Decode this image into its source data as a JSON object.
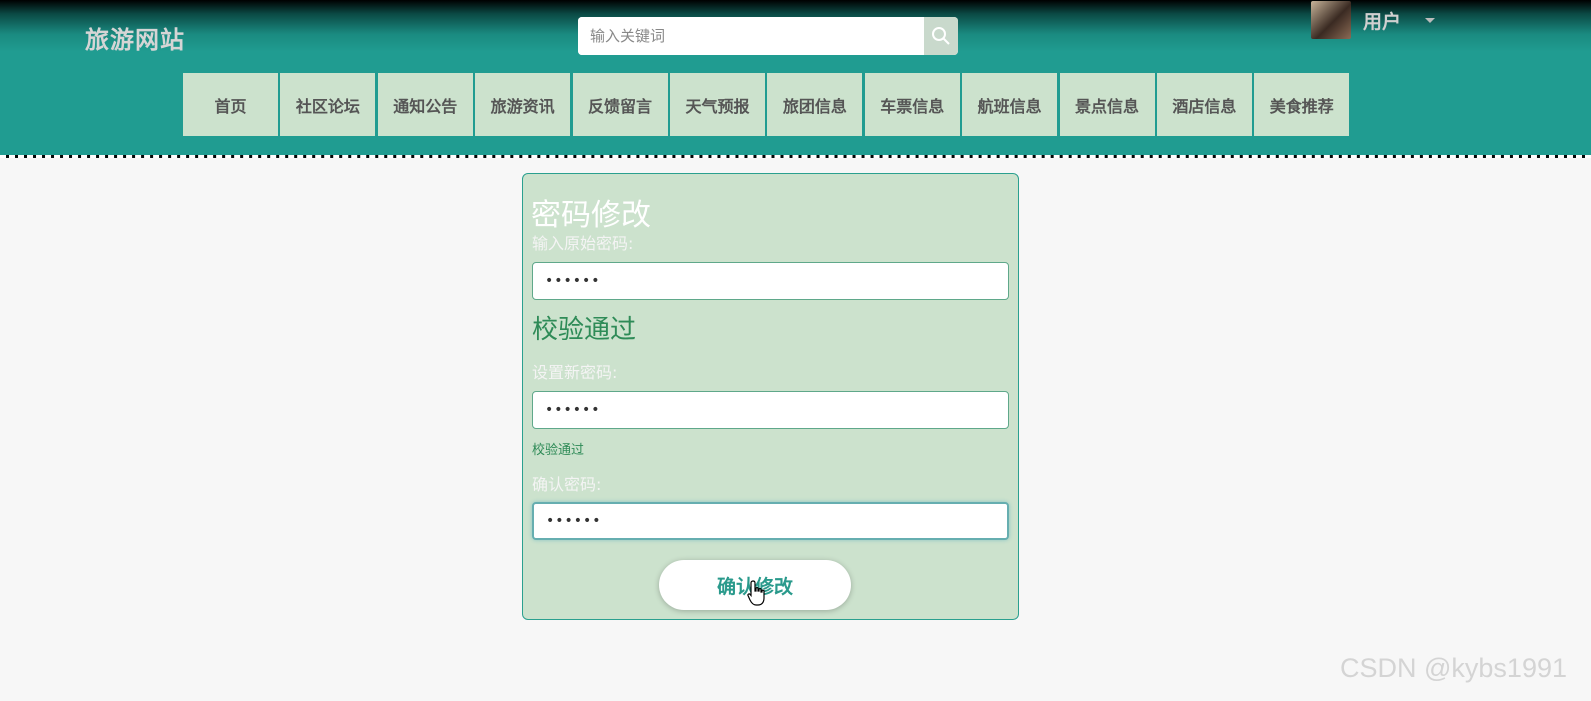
{
  "header": {
    "site_title": "旅游网站",
    "search": {
      "placeholder": "输入关键词",
      "value": ""
    },
    "user": {
      "label": "用户"
    }
  },
  "nav": {
    "items": [
      {
        "label": "首页"
      },
      {
        "label": "社区论坛"
      },
      {
        "label": "通知公告"
      },
      {
        "label": "旅游资讯"
      },
      {
        "label": "反馈留言"
      },
      {
        "label": "天气预报"
      },
      {
        "label": "旅团信息"
      },
      {
        "label": "车票信息"
      },
      {
        "label": "航班信息"
      },
      {
        "label": "景点信息"
      },
      {
        "label": "酒店信息"
      },
      {
        "label": "美食推荐"
      }
    ]
  },
  "form": {
    "title": "密码修改",
    "old_password": {
      "label": "输入原始密码:",
      "value": "••••••"
    },
    "old_check": "校验通过",
    "new_password": {
      "label": "设置新密码:",
      "value": "••••••"
    },
    "new_check": "校验通过",
    "confirm_password": {
      "label": "确认密码:",
      "value": "••••••"
    },
    "submit_label": "确认修改"
  },
  "watermark": "CSDN @kybs1991",
  "colors": {
    "header_teal": "#209c91",
    "nav_bg": "#cce2cd",
    "card_bg": "#cce2cd",
    "valid_green": "#2e8b57",
    "button_text": "#2a9a8c"
  },
  "icons": {
    "search": "search-icon",
    "caret": "caret-down-icon",
    "cursor": "hand-pointer-icon"
  }
}
